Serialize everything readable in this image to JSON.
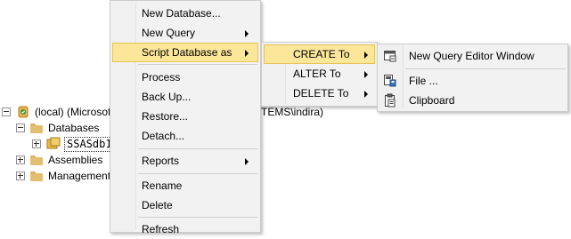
{
  "tree": {
    "server_label": "(local) (Microsoft",
    "server_label_tail": "TEMS\\indira)",
    "databases": "Databases",
    "selected_db": "SSASdb1",
    "assemblies": "Assemblies",
    "management": "Management"
  },
  "context_menu": {
    "items": [
      "New Database...",
      "New Query",
      "Script Database as",
      "Process",
      "Back Up...",
      "Restore...",
      "Detach...",
      "Reports",
      "Rename",
      "Delete",
      "Refresh"
    ]
  },
  "script_submenu": {
    "items": [
      "CREATE To",
      "ALTER To",
      "DELETE To"
    ]
  },
  "create_submenu": {
    "items": [
      "New Query Editor Window",
      "File ...",
      "Clipboard"
    ]
  },
  "colors": {
    "highlight": "#fbe69a",
    "highlight_border": "#e8c35a",
    "menu_bg": "#f2f2f2"
  }
}
